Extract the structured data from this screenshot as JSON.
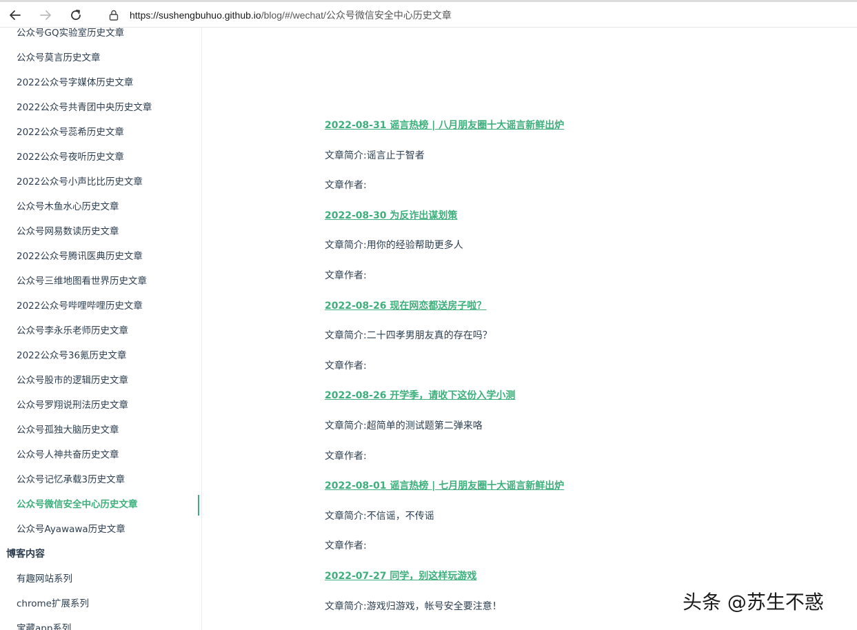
{
  "browser": {
    "url_host": "https://sushengbuhuo.github.io",
    "url_path": "/blog/#/wechat/公众号微信安全中心历史文章"
  },
  "sidebar": {
    "items": [
      {
        "label": "公众号GQ实验室历史文章"
      },
      {
        "label": "公众号莫言历史文章"
      },
      {
        "label": "2022公众号字媒体历史文章"
      },
      {
        "label": "2022公众号共青团中央历史文章"
      },
      {
        "label": "2022公众号蕊希历史文章"
      },
      {
        "label": "2022公众号夜听历史文章"
      },
      {
        "label": "2022公众号小声比比历史文章"
      },
      {
        "label": "公众号木鱼水心历史文章"
      },
      {
        "label": "公众号网易数读历史文章"
      },
      {
        "label": "2022公众号腾讯医典历史文章"
      },
      {
        "label": "公众号三维地图看世界历史文章"
      },
      {
        "label": "2022公众号哔哩哔哩历史文章"
      },
      {
        "label": "公众号李永乐老师历史文章"
      },
      {
        "label": "2022公众号36氪历史文章"
      },
      {
        "label": "公众号股市的逻辑历史文章"
      },
      {
        "label": "公众号罗翔说刑法历史文章"
      },
      {
        "label": "公众号孤独大脑历史文章"
      },
      {
        "label": "公众号人神共奋历史文章"
      },
      {
        "label": "公众号记忆承载3历史文章"
      },
      {
        "label": "公众号微信安全中心历史文章"
      },
      {
        "label": "公众号Ayawawa历史文章"
      }
    ],
    "group_title": "博客内容",
    "group_items": [
      {
        "label": "有趣网站系列"
      },
      {
        "label": "chrome扩展系列"
      },
      {
        "label": "宝藏app系列"
      }
    ]
  },
  "articles": [
    {
      "title": "2022-08-31 谣言热榜 | 八月朋友圈十大谣言新鲜出炉",
      "summary": "文章简介:谣言止于智者",
      "author": "文章作者:"
    },
    {
      "title": "2022-08-30 为反诈出谋划策",
      "summary": "文章简介:用你的经验帮助更多人",
      "author": "文章作者:"
    },
    {
      "title": "2022-08-26 现在网恋都送房子啦？",
      "summary": "文章简介:二十四孝男朋友真的存在吗？",
      "author": "文章作者:"
    },
    {
      "title": "2022-08-26 开学季，请收下这份入学小测",
      "summary": "文章简介:超简单的测试题第二弹来咯",
      "author": "文章作者:"
    },
    {
      "title": "2022-08-01 谣言热榜 | 七月朋友圈十大谣言新鲜出炉",
      "summary": "文章简介:不信谣，不传谣",
      "author": "文章作者:"
    },
    {
      "title": "2022-07-27 同学，别这样玩游戏",
      "summary": "文章简介:游戏归游戏，帐号安全要注意！",
      "author": ""
    }
  ],
  "watermark": "头条 @苏生不惑"
}
